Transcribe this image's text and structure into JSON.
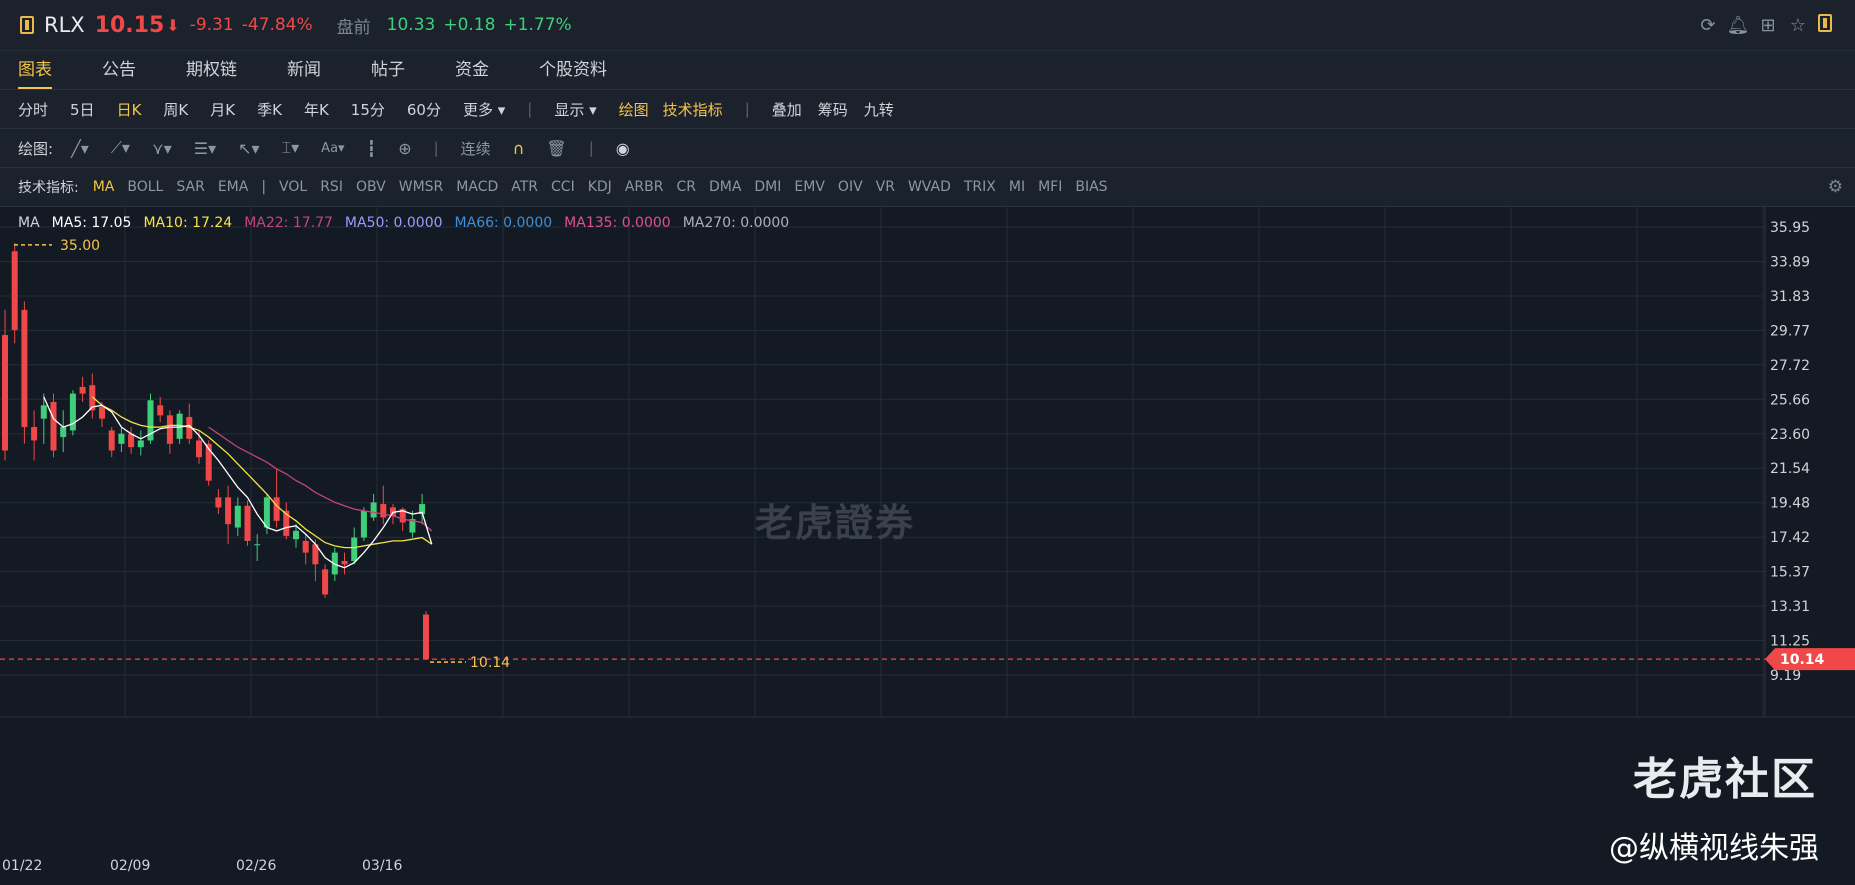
{
  "header": {
    "symbol": "RLX",
    "price": "10.15",
    "price_arrow": "⬇",
    "change": "-9.31",
    "change_pct": "-47.84%",
    "premarket_label": "盘前",
    "premarket_price": "10.33",
    "premarket_change": "+0.18",
    "premarket_pct": "+1.77%",
    "icons": [
      "refresh-icon",
      "bell-icon",
      "grid-icon",
      "star-icon",
      "layout-icon"
    ]
  },
  "tabs": [
    {
      "label": "图表",
      "active": true
    },
    {
      "label": "公告"
    },
    {
      "label": "期权链"
    },
    {
      "label": "新闻"
    },
    {
      "label": "帖子"
    },
    {
      "label": "资金"
    },
    {
      "label": "个股资料"
    }
  ],
  "periods": {
    "items": [
      "分时",
      "5日",
      "日K",
      "周K",
      "月K",
      "季K",
      "年K",
      "15分",
      "60分",
      "更多 ▾"
    ],
    "active": "日K",
    "display_label": "显示 ▾",
    "draw_label": "绘图",
    "tech_label": "技术指标",
    "extra": [
      "叠加",
      "筹码",
      "九转"
    ]
  },
  "drawbar": {
    "label": "绘图:",
    "continuous_label": "连续"
  },
  "indicators": {
    "label": "技术指标:",
    "items": [
      "MA",
      "BOLL",
      "SAR",
      "EMA",
      "|",
      "VOL",
      "RSI",
      "OBV",
      "WMSR",
      "MACD",
      "ATR",
      "CCI",
      "KDJ",
      "ARBR",
      "CR",
      "DMA",
      "DMI",
      "EMV",
      "OIV",
      "VR",
      "WVAD",
      "TRIX",
      "MI",
      "MFI",
      "BIAS"
    ],
    "active": "MA"
  },
  "legend": {
    "ma": "MA",
    "ma5": "MA5: 17.05",
    "ma10": "MA10: 17.24",
    "ma22": "MA22: 17.77",
    "ma50": "MA50: 0.0000",
    "ma66": "MA66: 0.0000",
    "ma135": "MA135: 0.0000",
    "ma270": "MA270: 0.0000",
    "colors": {
      "ma5": "#ffffff",
      "ma10": "#f5e447",
      "ma22": "#c2457a",
      "ma50": "#9b9bff",
      "ma66": "#3d8fd8",
      "ma135": "#e0508a",
      "ma270": "#c9ced6"
    }
  },
  "chart_data": {
    "type": "candlestick",
    "title": "",
    "ylim": [
      8.5,
      36.5
    ],
    "y_ticks": [
      "35.95",
      "33.89",
      "31.83",
      "29.77",
      "27.72",
      "25.66",
      "23.60",
      "21.54",
      "19.48",
      "17.42",
      "15.37",
      "13.31",
      "11.25",
      "9.19"
    ],
    "x_ticks": [
      "01/22",
      "02/09",
      "02/26",
      "03/16"
    ],
    "high_marker": "35.00",
    "last_price": "10.14",
    "colors": {
      "up": "#3fcf7a",
      "down": "#f04848",
      "grid": "#242c37"
    },
    "candles": [
      {
        "o": 29.5,
        "c": 22.6,
        "h": 31.0,
        "l": 22.0
      },
      {
        "o": 34.5,
        "c": 29.8,
        "h": 35.0,
        "l": 29.0
      },
      {
        "o": 31.0,
        "c": 24.0,
        "h": 31.5,
        "l": 23.0
      },
      {
        "o": 24.0,
        "c": 23.2,
        "h": 25.0,
        "l": 22.0
      },
      {
        "o": 24.5,
        "c": 25.3,
        "h": 26.0,
        "l": 23.0
      },
      {
        "o": 25.5,
        "c": 22.6,
        "h": 26.0,
        "l": 22.2
      },
      {
        "o": 23.4,
        "c": 24.0,
        "h": 25.0,
        "l": 22.5
      },
      {
        "o": 23.8,
        "c": 26.0,
        "h": 26.2,
        "l": 23.5
      },
      {
        "o": 26.4,
        "c": 26.0,
        "h": 27.0,
        "l": 25.5
      },
      {
        "o": 26.5,
        "c": 25.0,
        "h": 27.2,
        "l": 24.5
      },
      {
        "o": 25.2,
        "c": 24.5,
        "h": 25.5,
        "l": 24.0
      },
      {
        "o": 23.8,
        "c": 22.6,
        "h": 24.0,
        "l": 22.2
      },
      {
        "o": 23.0,
        "c": 23.6,
        "h": 24.0,
        "l": 22.5
      },
      {
        "o": 23.6,
        "c": 22.8,
        "h": 24.0,
        "l": 22.4
      },
      {
        "o": 22.8,
        "c": 23.2,
        "h": 23.8,
        "l": 22.3
      },
      {
        "o": 23.2,
        "c": 25.6,
        "h": 26.0,
        "l": 23.0
      },
      {
        "o": 25.3,
        "c": 24.7,
        "h": 25.8,
        "l": 24.3
      },
      {
        "o": 24.7,
        "c": 23.0,
        "h": 25.0,
        "l": 22.4
      },
      {
        "o": 23.3,
        "c": 24.8,
        "h": 25.0,
        "l": 23.0
      },
      {
        "o": 24.6,
        "c": 23.3,
        "h": 25.4,
        "l": 23.0
      },
      {
        "o": 23.2,
        "c": 22.2,
        "h": 23.8,
        "l": 21.8
      },
      {
        "o": 23.0,
        "c": 20.8,
        "h": 23.2,
        "l": 20.5
      },
      {
        "o": 19.8,
        "c": 19.2,
        "h": 20.3,
        "l": 18.8
      },
      {
        "o": 19.8,
        "c": 18.2,
        "h": 20.5,
        "l": 17.0
      },
      {
        "o": 18.0,
        "c": 19.3,
        "h": 19.8,
        "l": 17.5
      },
      {
        "o": 19.3,
        "c": 17.2,
        "h": 19.6,
        "l": 16.9
      },
      {
        "o": 17.0,
        "c": 17.0,
        "h": 17.6,
        "l": 16.0
      },
      {
        "o": 18.0,
        "c": 19.8,
        "h": 20.0,
        "l": 17.6
      },
      {
        "o": 19.8,
        "c": 18.4,
        "h": 21.5,
        "l": 18.0
      },
      {
        "o": 19.0,
        "c": 17.5,
        "h": 19.5,
        "l": 17.3
      },
      {
        "o": 17.3,
        "c": 17.8,
        "h": 18.2,
        "l": 16.8
      },
      {
        "o": 17.2,
        "c": 16.5,
        "h": 17.6,
        "l": 15.8
      },
      {
        "o": 17.0,
        "c": 15.8,
        "h": 17.3,
        "l": 14.8
      },
      {
        "o": 15.5,
        "c": 14.0,
        "h": 15.8,
        "l": 13.8
      },
      {
        "o": 15.2,
        "c": 16.5,
        "h": 16.8,
        "l": 14.8
      },
      {
        "o": 16.0,
        "c": 15.8,
        "h": 16.5,
        "l": 15.2
      },
      {
        "o": 16.0,
        "c": 17.4,
        "h": 18.0,
        "l": 15.8
      },
      {
        "o": 17.4,
        "c": 19.0,
        "h": 19.2,
        "l": 17.2
      },
      {
        "o": 18.6,
        "c": 19.5,
        "h": 20.0,
        "l": 18.4
      },
      {
        "o": 19.4,
        "c": 18.6,
        "h": 20.5,
        "l": 18.2
      },
      {
        "o": 19.2,
        "c": 18.7,
        "h": 19.4,
        "l": 18.2
      },
      {
        "o": 19.1,
        "c": 18.3,
        "h": 19.2,
        "l": 17.8
      },
      {
        "o": 17.7,
        "c": 18.5,
        "h": 19.0,
        "l": 17.4
      },
      {
        "o": 18.8,
        "c": 19.4,
        "h": 20.0,
        "l": 18.2
      },
      {
        "o": 12.8,
        "c": 10.14,
        "h": 13.0,
        "l": 10.1
      }
    ],
    "ma5": [
      null,
      null,
      null,
      null,
      25.8,
      24.5,
      24.0,
      24.2,
      24.6,
      25.2,
      25.3,
      24.9,
      24.0,
      23.6,
      23.3,
      23.6,
      23.9,
      24.0,
      24.0,
      24.1,
      23.5,
      22.7,
      22.0,
      21.2,
      20.4,
      19.8,
      18.8,
      18.0,
      17.8,
      18.0,
      18.1,
      17.6,
      17.0,
      16.2,
      15.8,
      15.6,
      15.9,
      16.5,
      17.2,
      18.0,
      18.9,
      19.0,
      18.8,
      18.9,
      17.0
    ],
    "ma10": [
      null,
      null,
      null,
      null,
      null,
      null,
      null,
      null,
      null,
      25.8,
      25.3,
      25.0,
      24.6,
      24.3,
      24.1,
      24.0,
      24.0,
      24.1,
      24.1,
      24.0,
      23.8,
      23.4,
      22.9,
      22.4,
      21.8,
      21.2,
      20.6,
      20.0,
      19.3,
      18.8,
      18.4,
      17.9,
      17.5,
      17.1,
      16.9,
      16.8,
      16.8,
      16.9,
      17.0,
      17.1,
      17.2,
      17.2,
      17.3,
      17.4,
      17.0
    ],
    "ma22": [
      null,
      null,
      null,
      null,
      null,
      null,
      null,
      null,
      null,
      null,
      null,
      null,
      null,
      null,
      null,
      null,
      null,
      null,
      null,
      null,
      null,
      24.0,
      23.6,
      23.2,
      22.8,
      22.5,
      22.2,
      21.9,
      21.5,
      21.2,
      20.8,
      20.5,
      20.1,
      19.8,
      19.5,
      19.3,
      19.1,
      19.0,
      18.9,
      18.8,
      18.7,
      18.5,
      18.4,
      18.3,
      17.8
    ]
  },
  "watermarks": {
    "center": "老虎證券",
    "community": "老虎社区",
    "author": "@纵横视线朱强"
  }
}
